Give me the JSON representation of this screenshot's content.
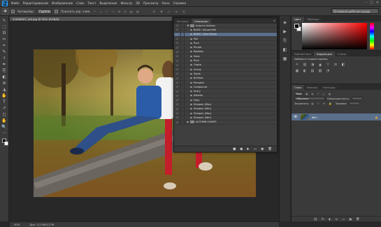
{
  "menubar": {
    "logo": "Ps",
    "items": [
      "Файл",
      "Редактирование",
      "Изображение",
      "Слои",
      "Текст",
      "Выделение",
      "Фильтр",
      "3D",
      "Просмотр",
      "Окно",
      "Справка"
    ],
    "window_controls": [
      "–",
      "□",
      "✕"
    ]
  },
  "options_bar": {
    "auto_select_label": "Автовыбор:",
    "auto_select_value": "Группа",
    "show_controls_label": "Показать упр. элем.",
    "workspace": "Основная рабочая среда"
  },
  "document": {
    "tab_title": "41626007_m0.jpg @ 50% (RGB/8)",
    "zoom": "50%",
    "doc_size": "Док: 5,27M/5,27M"
  },
  "tools": [
    "↖",
    "⬚",
    "ʘ",
    "✂",
    "⌖",
    "✎",
    "⚕",
    "✒",
    "⎘",
    "◐",
    "⊘",
    "◮",
    "✋",
    "T",
    "↗",
    "◻",
    "✋",
    "🔍",
    "···"
  ],
  "actions_panel": {
    "tabs": [
      "История",
      "Операции"
    ],
    "menu_icon": "≡",
    "rows": [
      {
        "label": "Autumn Actions",
        "type": "set",
        "open": true,
        "sel": false
      },
      {
        "label": "BASIC: AutumnFall",
        "type": "action",
        "open": false,
        "sel": false
      },
      {
        "label": "BASIC: Color Boost",
        "type": "action",
        "open": false,
        "sel": true
      },
      {
        "label": "Fall",
        "type": "action",
        "open": false,
        "sel": false
      },
      {
        "label": "Pure",
        "type": "action",
        "open": false,
        "sel": false
      },
      {
        "label": "Purple",
        "type": "action",
        "open": false,
        "sel": false
      },
      {
        "label": "Reddish",
        "type": "action",
        "open": false,
        "sel": false
      },
      {
        "label": "Solar",
        "type": "action",
        "open": false,
        "sel": false
      },
      {
        "label": "Pure",
        "type": "action",
        "open": false,
        "sel": false
      },
      {
        "label": "Castle",
        "type": "action",
        "open": false,
        "sel": false
      },
      {
        "label": "Sunny",
        "type": "action",
        "open": false,
        "sel": false
      },
      {
        "label": "Sepia",
        "type": "action",
        "open": false,
        "sel": false
      },
      {
        "label": "Brilliant",
        "type": "action",
        "open": false,
        "sel": false
      },
      {
        "label": "Pumpkin",
        "type": "action",
        "open": false,
        "sel": false
      },
      {
        "label": "Compound",
        "type": "action",
        "open": false,
        "sel": false
      },
      {
        "label": "Scary",
        "type": "action",
        "open": false,
        "sel": false
      },
      {
        "label": "Sabella",
        "type": "action",
        "open": false,
        "sel": false
      },
      {
        "label": "Fairy",
        "type": "action",
        "open": false,
        "sel": false
      },
      {
        "label": "Sharpen (Mac)",
        "type": "action",
        "open": false,
        "sel": false
      },
      {
        "label": "Sharpen (Win)",
        "type": "action",
        "open": false,
        "sel": false
      },
      {
        "label": "Sharpen (Mac)",
        "type": "action",
        "open": false,
        "sel": false
      },
      {
        "label": "Sharpen (Win)",
        "type": "action",
        "open": false,
        "sel": false
      },
      {
        "label": "AUTUMN LEAVES",
        "type": "set",
        "open": false,
        "sel": false
      }
    ],
    "footer_icons": [
      "■",
      "●",
      "▶",
      "▭",
      "▣",
      "🗑"
    ]
  },
  "color_panel": {
    "tabs": [
      "Цвет",
      "Образцы"
    ]
  },
  "adjustments_panel": {
    "tabs": [
      "Библиотеки",
      "Коррекция",
      "Стили"
    ],
    "title": "Добавить корректировку",
    "icons": [
      "☼",
      "▥",
      "◑",
      "▲",
      "▽",
      "⚖",
      "◧",
      "▦",
      "◐",
      "▤",
      "▧",
      "◔"
    ]
  },
  "layers_panel": {
    "tabs": [
      "Слои",
      "Каналы",
      "Контуры"
    ],
    "kind": "Вид",
    "blend": "Обычные",
    "opacity_label": "Непрозрачность:",
    "fill_label": "Заливка:",
    "lock_label": "Закрепить:",
    "layer_name": "Фон",
    "footer_icons": [
      "⛓",
      "fx",
      "◐",
      "◎",
      "▭",
      "▣",
      "🗑"
    ]
  },
  "mini_col_icons": [
    "◈",
    "▶",
    "⎘",
    "◧",
    "▦"
  ]
}
